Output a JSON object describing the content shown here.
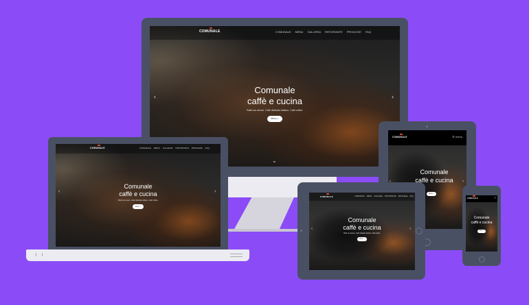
{
  "brand": {
    "logo": "COMUNALE"
  },
  "nav": {
    "items": [
      "COMUNALE",
      "MENU",
      "GALLERIA",
      "RISTORANTE",
      "PRIVILEGE",
      "FAQ"
    ]
  },
  "hero": {
    "line1": "Comunale",
    "line2": "caffè e cucina",
    "tagline": "Piatti con amore. Cafè ribeltrato italiano. Cafè coffee.",
    "button": "Menu >"
  },
  "tablet_menu": {
    "label": "menu"
  },
  "colors": {
    "background": "#8b4cf7",
    "device_frame": "#4a5063",
    "accent": "#d14b2a"
  }
}
